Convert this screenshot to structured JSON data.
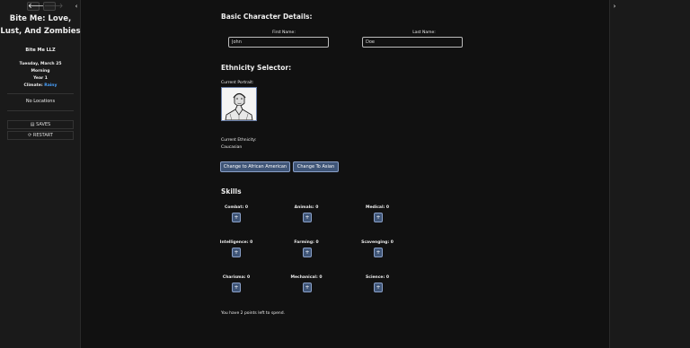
{
  "nav": {
    "back": "🡐",
    "forward": "🡒",
    "left_collapse": "‹",
    "right_collapse": "›"
  },
  "sidebar": {
    "title": "Bite Me: Love, Lust, And Zombies",
    "author": "Bite Me LLZ",
    "date": "Tuesday, March 25",
    "time_of_day": "Morning",
    "year": "Year 1",
    "climate_label": "Climate:",
    "climate_value": "Rainy",
    "locations": "No Locations",
    "saves_label": "SAVES",
    "restart_label": "RESTART"
  },
  "details": {
    "heading": "Basic Character Details:",
    "first_name_label": "First Name:",
    "first_name_value": "John",
    "last_name_label": "Last Name:",
    "last_name_value": "Doe"
  },
  "ethnicity": {
    "heading": "Ethnicity Selector:",
    "portrait_label": "Current Portrait:",
    "current_label": "Current Ethnicity:",
    "current_value": "Caucasian",
    "btn_african": "Change to African American",
    "btn_asian": "Change To Asian"
  },
  "skills": {
    "heading": "Skills",
    "items": [
      {
        "label": "Combat: 0"
      },
      {
        "label": "Animals: 0"
      },
      {
        "label": "Medical: 0"
      },
      {
        "label": "Intelligence: 0"
      },
      {
        "label": "Farming: 0"
      },
      {
        "label": "Scavenging: 0"
      },
      {
        "label": "Charisma: 0"
      },
      {
        "label": "Mechanical: 0"
      },
      {
        "label": "Science: 0"
      }
    ],
    "plus": "+",
    "points_text": "You have 2 points left to spend."
  }
}
